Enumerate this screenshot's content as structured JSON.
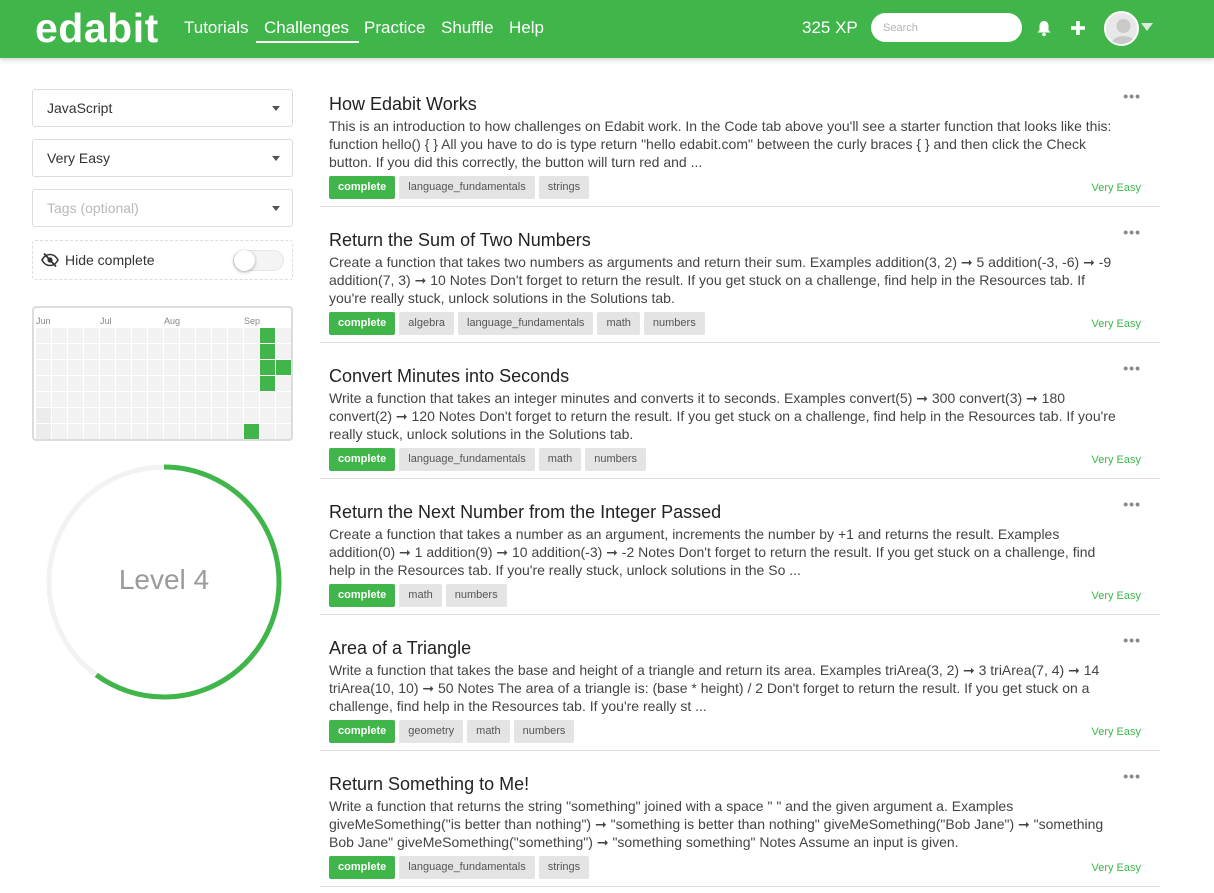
{
  "nav": {
    "logo": "edabit",
    "links": [
      "Tutorials",
      "Challenges",
      "Practice",
      "Shuffle",
      "Help"
    ],
    "active": "Challenges",
    "xp": "325 XP",
    "search_placeholder": "Search",
    "icons": [
      "bell-icon",
      "plus-icon",
      "avatar",
      "chevron-down-icon"
    ],
    "brand_color": "#3fb54a"
  },
  "sidebar": {
    "language": "JavaScript",
    "difficulty": "Very Easy",
    "tags_placeholder": "Tags (optional)",
    "hide_complete_label": "Hide complete",
    "hide_complete_on": false,
    "heatmap": {
      "months": [
        "Jun",
        "Jul",
        "Aug",
        "Sep"
      ],
      "active_color": "#3fb54a"
    },
    "level": {
      "label": "Level 4",
      "progress": 0.6
    }
  },
  "challenges": [
    {
      "title": "How Edabit Works",
      "description": "This is an introduction to how challenges on Edabit work. In the Code tab above you'll see a starter function that looks like this: function hello() { } All you have to do is type return \"hello edabit.com\" between the curly braces { } and then click the Check button. If you did this correctly, the button will turn red and ...",
      "status": "complete",
      "tags": [
        "language_fundamentals",
        "strings"
      ],
      "difficulty": "Very Easy"
    },
    {
      "title": "Return the Sum of Two Numbers",
      "description": "Create a function that takes two numbers as arguments and return their sum. Examples addition(3, 2) ➞ 5 addition(-3, -6) ➞ -9 addition(7, 3) ➞ 10 Notes Don't forget to return the result. If you get stuck on a challenge, find help in the Resources tab. If you're really stuck, unlock solutions in the Solutions tab.",
      "status": "complete",
      "tags": [
        "algebra",
        "language_fundamentals",
        "math",
        "numbers"
      ],
      "difficulty": "Very Easy"
    },
    {
      "title": "Convert Minutes into Seconds",
      "description": "Write a function that takes an integer minutes and converts it to seconds. Examples convert(5) ➞ 300 convert(3) ➞ 180 convert(2) ➞ 120 Notes Don't forget to return the result. If you get stuck on a challenge, find help in the Resources tab. If you're really stuck, unlock solutions in the Solutions tab.",
      "status": "complete",
      "tags": [
        "language_fundamentals",
        "math",
        "numbers"
      ],
      "difficulty": "Very Easy"
    },
    {
      "title": "Return the Next Number from the Integer Passed",
      "description": "Create a function that takes a number as an argument, increments the number by +1 and returns the result. Examples addition(0) ➞ 1 addition(9) ➞ 10 addition(-3) ➞ -2 Notes Don't forget to return the result. If you get stuck on a challenge, find help in the Resources tab. If you're really stuck, unlock solutions in the So ...",
      "status": "complete",
      "tags": [
        "math",
        "numbers"
      ],
      "difficulty": "Very Easy"
    },
    {
      "title": "Area of a Triangle",
      "description": "Write a function that takes the base and height of a triangle and return its area. Examples triArea(3, 2) ➞ 3 triArea(7, 4) ➞ 14 triArea(10, 10) ➞ 50 Notes The area of a triangle is: (base * height) / 2 Don't forget to return the result. If you get stuck on a challenge, find help in the Resources tab. If you're really st ...",
      "status": "complete",
      "tags": [
        "geometry",
        "math",
        "numbers"
      ],
      "difficulty": "Very Easy"
    },
    {
      "title": "Return Something to Me!",
      "description": "Write a function that returns the string \"something\" joined with a space \" \" and the given argument a. Examples giveMeSomething(\"is better than nothing\") ➞ \"something is better than nothing\" giveMeSomething(\"Bob Jane\") ➞ \"something Bob Jane\" giveMeSomething(\"something\") ➞ \"something something\" Notes Assume an input is given.",
      "status": "complete",
      "tags": [
        "language_fundamentals",
        "strings"
      ],
      "difficulty": "Very Easy"
    }
  ]
}
